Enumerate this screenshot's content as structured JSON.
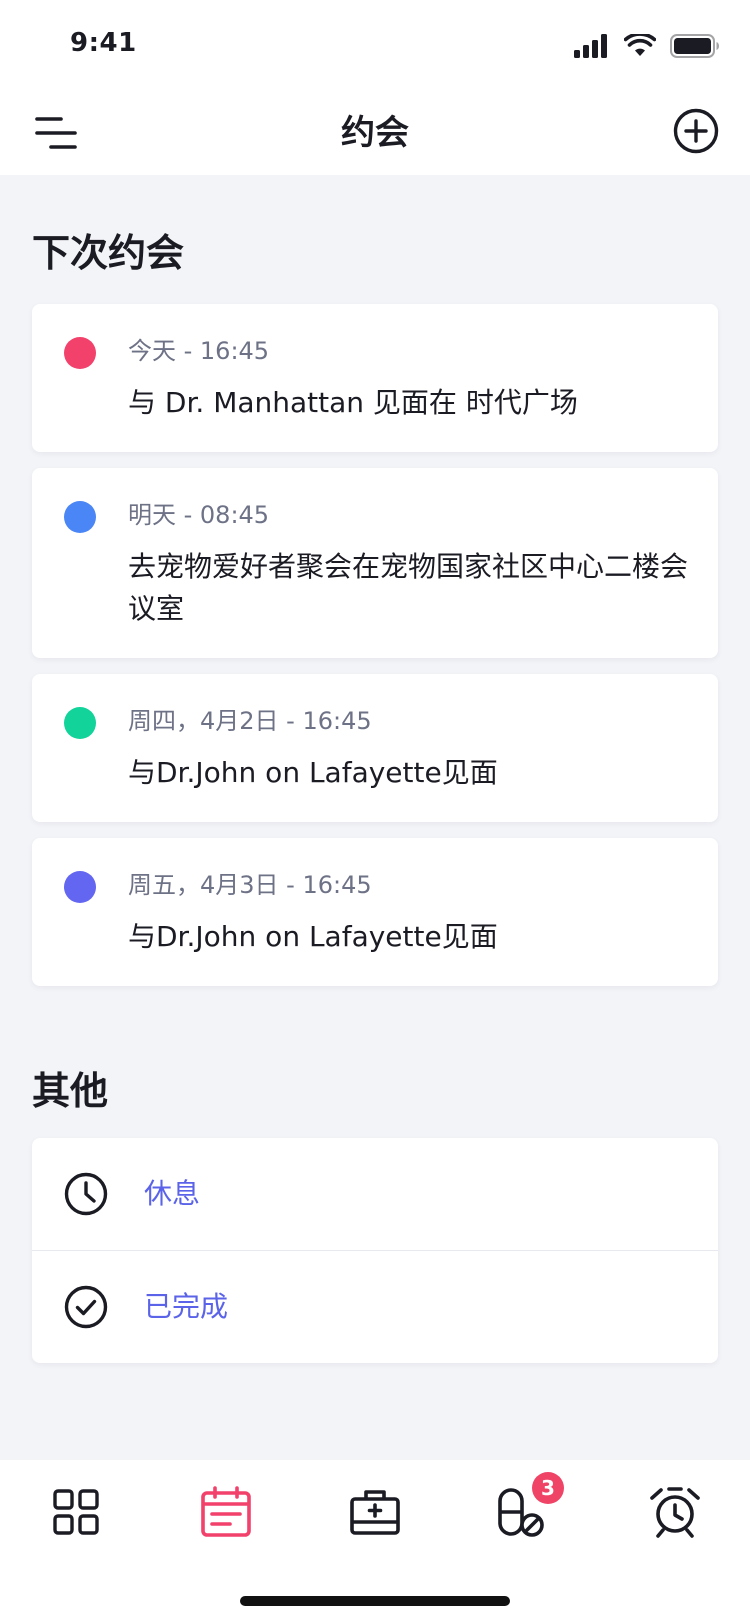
{
  "status_bar": {
    "time": "9:41"
  },
  "header": {
    "title": "约会"
  },
  "upcoming": {
    "title": "下次约会",
    "items": [
      {
        "when": "今天 - 16:45",
        "what": "与 Dr. Manhattan 见面在 时代广场",
        "color": "#F2416B"
      },
      {
        "when": "明天 - 08:45",
        "what": "去宠物爱好者聚会在宠物国家社区中心二楼会议室",
        "color": "#4A86F5"
      },
      {
        "when": "周四，4月2日 - 16:45",
        "what": "与Dr.John on Lafayette见面",
        "color": "#12D39A"
      },
      {
        "when": "周五，4月3日 - 16:45",
        "what": "与Dr.John on Lafayette见面",
        "color": "#6366F1"
      }
    ]
  },
  "others": {
    "title": "其他",
    "items": [
      {
        "label": "休息",
        "icon": "clock-icon"
      },
      {
        "label": "已完成",
        "icon": "check-circle-icon"
      }
    ]
  },
  "tabbar": {
    "tabs": [
      {
        "icon": "grid-icon",
        "active": false
      },
      {
        "icon": "calendar-icon",
        "active": true
      },
      {
        "icon": "medical-kit-icon",
        "active": false
      },
      {
        "icon": "pill-icon",
        "active": false,
        "badge": "3"
      },
      {
        "icon": "alarm-clock-icon",
        "active": false
      }
    ],
    "active_color": "#F2416B",
    "inactive_color": "#1B1B24"
  }
}
